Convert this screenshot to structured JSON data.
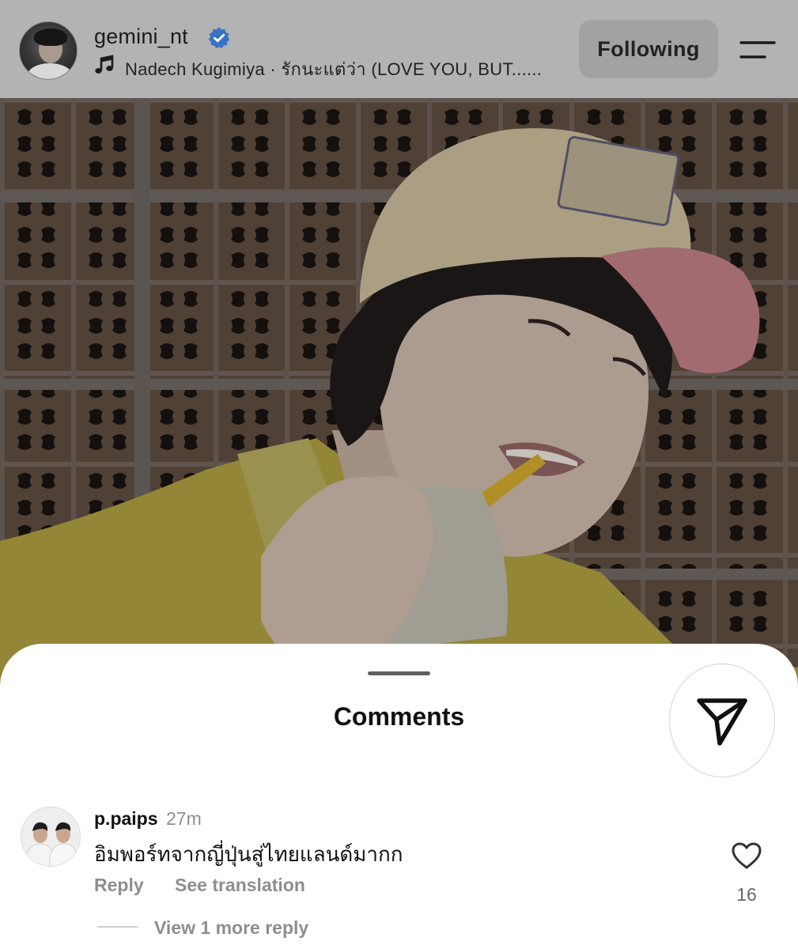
{
  "header": {
    "username": "gemini_nt",
    "verified": true,
    "song": "Nadech Kugimiya · รักนะแต่ว่า (LOVE YOU, BUT......",
    "follow_label": "Following",
    "icons": {
      "music": "music-note-icon",
      "menu": "menu-icon",
      "verified": "verified-badge-icon"
    }
  },
  "colors": {
    "verified_blue": "#3897f0",
    "header_bg": "#b3b3b3",
    "follow_btn_bg": "#a2a2a2",
    "muted_text": "#8e8e8e"
  },
  "comments_sheet": {
    "title": "Comments",
    "share_icon": "send-icon",
    "comments": [
      {
        "user": "p.paips",
        "time": "27m",
        "text": "อิมพอร์ทจากญี่ปุ่นสู่ไทยแลนด์มากก",
        "reply_label": "Reply",
        "translate_label": "See translation",
        "likes": "16",
        "view_replies_label": "View 1 more reply"
      }
    ]
  }
}
